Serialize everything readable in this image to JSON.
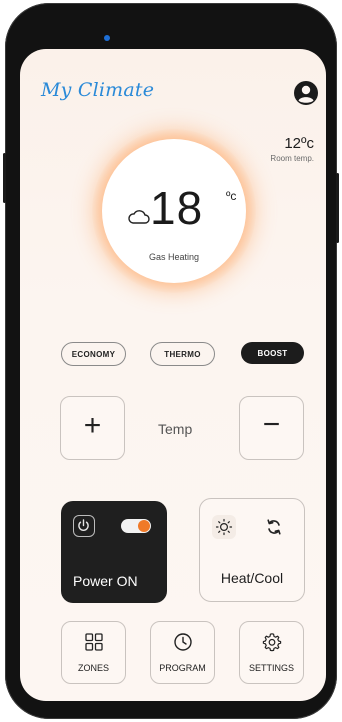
{
  "app": {
    "title": "My Climate"
  },
  "room": {
    "temperature": "12ºc",
    "label": "Room temp."
  },
  "dial": {
    "temperature": "18",
    "unit": "ºc",
    "mode": "Gas Heating"
  },
  "modes": [
    {
      "label": "ECONOMY",
      "active": false
    },
    {
      "label": "THERMO",
      "active": false
    },
    {
      "label": "BOOST",
      "active": true
    }
  ],
  "temp_control": {
    "plus": "+",
    "label": "Temp",
    "minus": "−"
  },
  "power": {
    "label": "Power ON",
    "on": true
  },
  "heatcool": {
    "label": "Heat/Cool"
  },
  "nav": [
    {
      "label": "ZONES",
      "icon": "grid-icon"
    },
    {
      "label": "PROGRAM",
      "icon": "clock-icon"
    },
    {
      "label": "SETTINGS",
      "icon": "gear-icon"
    }
  ],
  "colors": {
    "accent": "#f07a28",
    "brand": "#2a8ad8",
    "dark": "#1f1f1f"
  }
}
